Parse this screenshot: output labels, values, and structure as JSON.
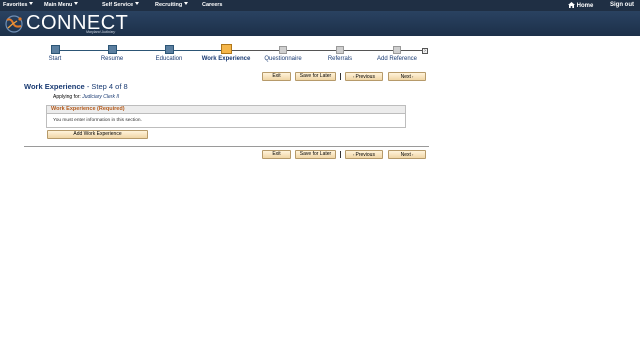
{
  "topnav": {
    "favorites": "Favorites",
    "main_menu": "Main Menu",
    "self_service": "Self Service",
    "recruiting": "Recruiting",
    "careers": "Careers",
    "home": "Home",
    "sign_out": "Sign out"
  },
  "banner": {
    "logo_text": "CONNECT",
    "logo_sub": "Maryland Judiciary"
  },
  "train": {
    "steps": [
      {
        "label": "Start"
      },
      {
        "label": "Resume"
      },
      {
        "label": "Education"
      },
      {
        "label": "Work Experience"
      },
      {
        "label": "Questionnaire"
      },
      {
        "label": "Referrals"
      },
      {
        "label": "Add Reference"
      }
    ],
    "current_index": 3
  },
  "buttons": {
    "exit": "Exit",
    "save_for_later": "Save for Later",
    "previous": "Previous",
    "next": "Next"
  },
  "page": {
    "title": "Work Experience",
    "step_info": "- Step 4 of 8",
    "applying_for_label": "Applying for:",
    "applying_for_job": "Judiciary Clerk II"
  },
  "section": {
    "header": "Work Experience (Required)",
    "message": "You must enter information in this section.",
    "add_button": "Add Work Experience"
  },
  "colors": {
    "nav_bg": "#1f2f44",
    "link_blue": "#1a3b73",
    "section_header_orange": "#b45a1b",
    "current_step": "#f5b64a"
  }
}
